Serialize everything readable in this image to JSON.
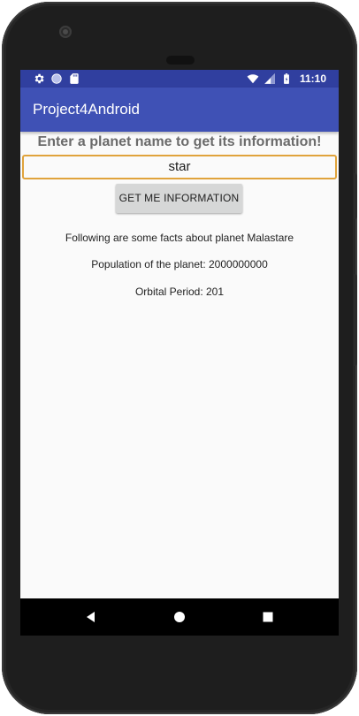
{
  "status_bar": {
    "time": "11:10",
    "left_icons": [
      "gear-icon",
      "circle-icon",
      "sd-card-icon"
    ],
    "right_icons": [
      "wifi-icon",
      "cell-signal-icon",
      "battery-icon"
    ]
  },
  "app_bar": {
    "title": "Project4Android"
  },
  "main": {
    "headline": "Enter a planet name to get its information!",
    "planet_input_value": "star",
    "get_button_label": "GET ME INFORMATION",
    "facts": [
      "Following are some facts about planet Malastare",
      "Population of the planet: 2000000000",
      "Orbital Period: 201"
    ]
  },
  "nav_bar": {
    "buttons": [
      "back-icon",
      "home-icon",
      "recents-icon"
    ]
  },
  "colors": {
    "status_bar": "#303f9f",
    "app_bar": "#3f51b5",
    "input_border": "#e0a33c",
    "button_bg": "#d6d7d7",
    "screen_bg": "#fafafa",
    "device_body": "#1e1e1e"
  }
}
